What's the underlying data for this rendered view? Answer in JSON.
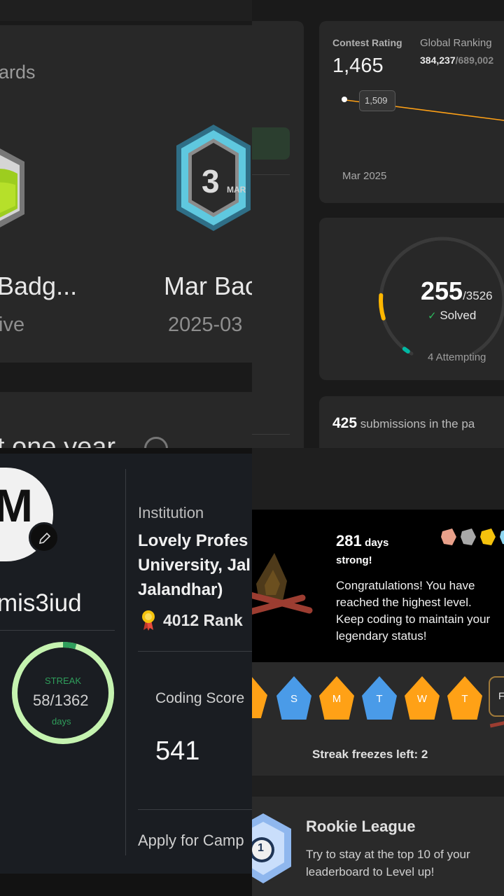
{
  "badges": {
    "section_title": "ards",
    "badge1_name": "Badg...",
    "badge1_sub": "ive",
    "badge2_name": "Mar Bac",
    "badge2_date": "2025-03",
    "badge2_number": "3",
    "badge2_month": "MAR",
    "bottom_title": "t one year"
  },
  "stats": {
    "contest_rating_label": "Contest Rating",
    "contest_rating_value": "1,465",
    "global_ranking_label": "Global Ranking",
    "global_ranking_value": "384,237",
    "global_ranking_total": "/689,002",
    "tooltip_value": "1,509",
    "chart_month": "Mar 2025",
    "solved_count": "255",
    "solved_total": "/3526",
    "solved_label": "Solved",
    "attempting": "4 Attempting",
    "submissions_count": "425",
    "submissions_text": "submissions in the pa",
    "progress_fraction": 0.0723,
    "ring_color": "#ffb700",
    "ring_track": "#3a3a3a"
  },
  "profile": {
    "avatar_letter": "M",
    "username": "mis3iud",
    "streak_label": "STREAK",
    "streak_value": "58/1362",
    "streak_unit": "days",
    "streak_fraction": 0.0426,
    "institution_label": "Institution",
    "institution_line1": "Lovely Profes",
    "institution_line2": "University, Jal",
    "institution_line3": "Jalandhar)",
    "rank": "4012 Rank",
    "coding_score_label": "Coding Score",
    "coding_score_value": "541",
    "apply_text": "Apply for Camp"
  },
  "streak": {
    "days_count": "281",
    "days_unit": "days",
    "strong": "strong!",
    "msg_line1": "Congratulations! You have",
    "msg_line2": "reached the highest level.",
    "msg_line3": "Keep coding to maintain your",
    "msg_line4": "legendary status!",
    "week_days": [
      "S",
      "M",
      "T",
      "W",
      "T",
      "F"
    ],
    "freezes": "Streak freezes left: 2",
    "league_title": "Rookie League",
    "league_line1": "Try to stay at the top 10 of your",
    "league_line2": "leaderboard to Level up!",
    "league_rank": "1"
  }
}
